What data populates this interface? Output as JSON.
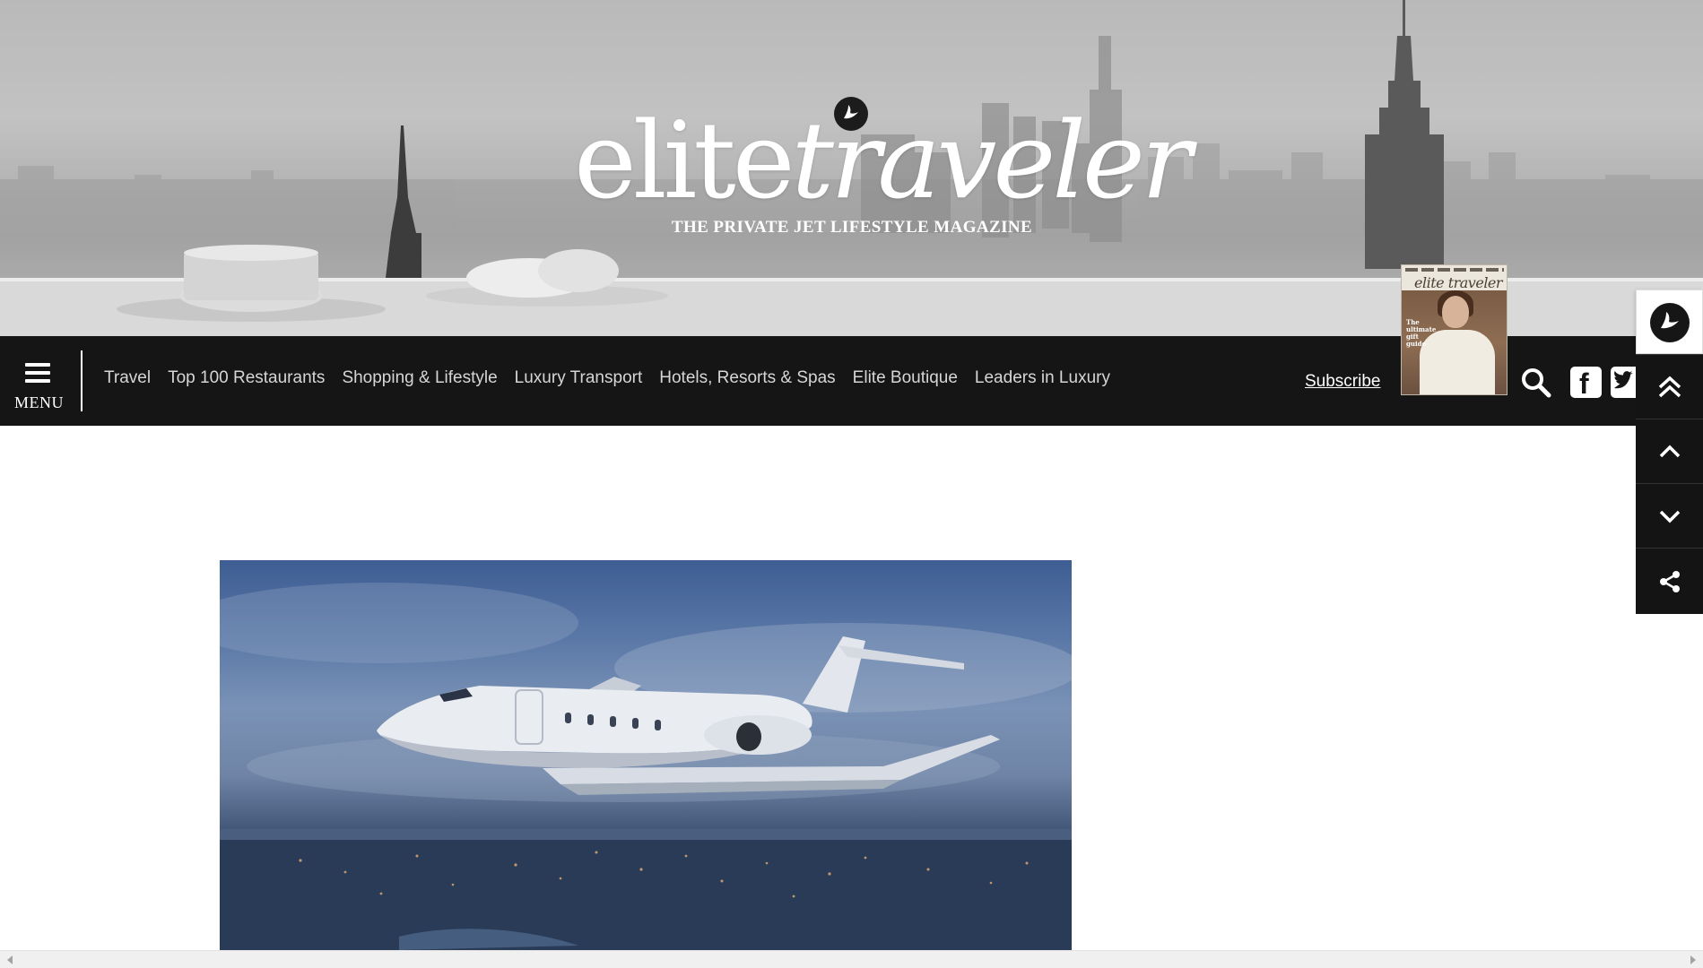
{
  "header": {
    "logo_word_1": "elite",
    "logo_word_2": "traveler",
    "tagline": "THE PRIVATE JET LIFESTYLE MAGAZINE"
  },
  "nav": {
    "menu_label": "MENU",
    "links": [
      "Travel",
      "Top 100 Restaurants",
      "Shopping & Lifestyle",
      "Luxury Transport",
      "Hotels, Resorts & Spas",
      "Elite Boutique",
      "Leaders in Luxury"
    ],
    "subscribe_label": "Subscribe"
  },
  "magazine_cover": {
    "title": "elite traveler",
    "cover_line": "The ultimate gift guide"
  },
  "icons": {
    "menu": "hamburger-icon",
    "search": "search-icon",
    "facebook": "facebook-icon",
    "twitter": "twitter-icon",
    "logo": "bird-logo-icon",
    "top": "double-chevron-up-icon",
    "up": "chevron-up-icon",
    "down": "chevron-down-icon",
    "share": "share-icon"
  },
  "colors": {
    "navbar": "#151515",
    "nav_link": "#d6d6d6",
    "side_toolbar": "#141414"
  }
}
